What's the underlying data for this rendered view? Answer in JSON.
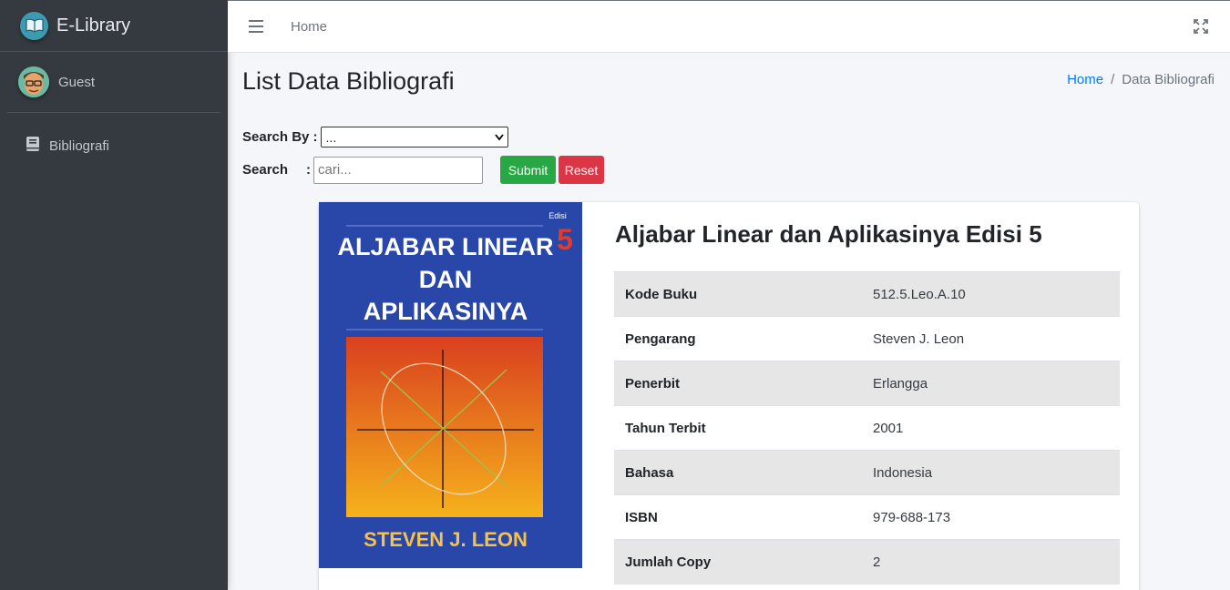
{
  "brand": {
    "name": "E-Library",
    "logo_icon": "open-book-icon"
  },
  "user": {
    "name": "Guest"
  },
  "sidebar": {
    "items": [
      {
        "label": "Bibliografi",
        "icon": "book-icon"
      }
    ]
  },
  "topbar": {
    "home_link": "Home"
  },
  "page": {
    "title": "List Data Bibliografi",
    "breadcrumb": {
      "home": "Home",
      "current": "Data Bibliografi",
      "separator": "/"
    }
  },
  "search": {
    "search_by_label": "Search By :",
    "search_by_value": "...",
    "search_label": "Search",
    "colon": ":",
    "placeholder": "cari...",
    "submit_label": "Submit",
    "reset_label": "Reset"
  },
  "book": {
    "title": "Aljabar Linear dan Aplikasinya Edisi 5",
    "cover": {
      "edition_word": "Edisi",
      "edition_number": "5",
      "line1": "ALJABAR LINEAR",
      "line2": "DAN",
      "line3": "APLIKASINYA",
      "author": "STEVEN J. LEON"
    },
    "details": [
      {
        "key": "Kode Buku",
        "value": "512.5.Leo.A.10"
      },
      {
        "key": "Pengarang",
        "value": "Steven J. Leon"
      },
      {
        "key": "Penerbit",
        "value": "Erlangga"
      },
      {
        "key": "Tahun Terbit",
        "value": "2001"
      },
      {
        "key": "Bahasa",
        "value": "Indonesia"
      },
      {
        "key": "ISBN",
        "value": "979-688-173"
      },
      {
        "key": "Jumlah Copy",
        "value": "2"
      }
    ]
  },
  "colors": {
    "sidebar": "#343a40",
    "submit": "#28a745",
    "reset": "#dc3545",
    "link": "#007bff",
    "cover_blue": "#2947a8"
  }
}
